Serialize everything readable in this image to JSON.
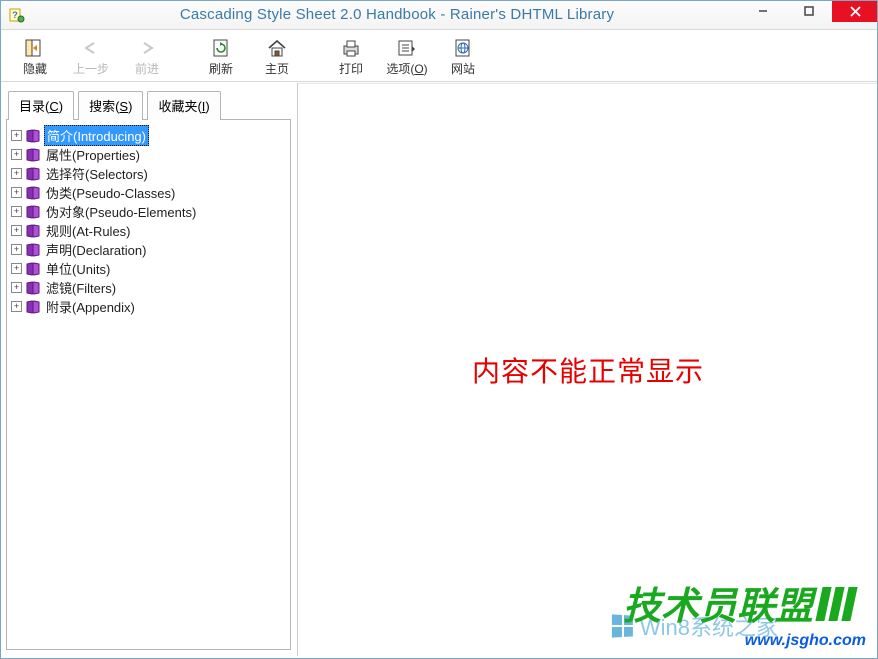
{
  "window": {
    "title": "Cascading Style Sheet 2.0 Handbook - Rainer's DHTML Library"
  },
  "toolbar": {
    "hide": "隐藏",
    "back": "上一步",
    "forward": "前进",
    "refresh": "刷新",
    "home": "主页",
    "print": "打印",
    "options": "选项(",
    "options_u": "O",
    "options_end": ")",
    "website": "网站"
  },
  "tabs": {
    "contents_pre": "目录(",
    "contents_u": "C",
    "contents_end": ")",
    "search_pre": "搜索(",
    "search_u": "S",
    "search_end": ")",
    "fav_pre": "收藏夹(",
    "fav_u": "I",
    "fav_end": ")"
  },
  "tree": [
    {
      "label": "简介(Introducing)",
      "selected": true
    },
    {
      "label": "属性(Properties)"
    },
    {
      "label": "选择符(Selectors)"
    },
    {
      "label": "伪类(Pseudo-Classes)"
    },
    {
      "label": "伪对象(Pseudo-Elements)"
    },
    {
      "label": "规则(At-Rules)"
    },
    {
      "label": "声明(Declaration)"
    },
    {
      "label": "单位(Units)"
    },
    {
      "label": "滤镜(Filters)"
    },
    {
      "label": "附录(Appendix)"
    }
  ],
  "content": {
    "error": "内容不能正常显示"
  },
  "watermarks": {
    "brand": "技术员联盟",
    "url": "www.jsgho.com",
    "win8": "Win8系统之家"
  }
}
